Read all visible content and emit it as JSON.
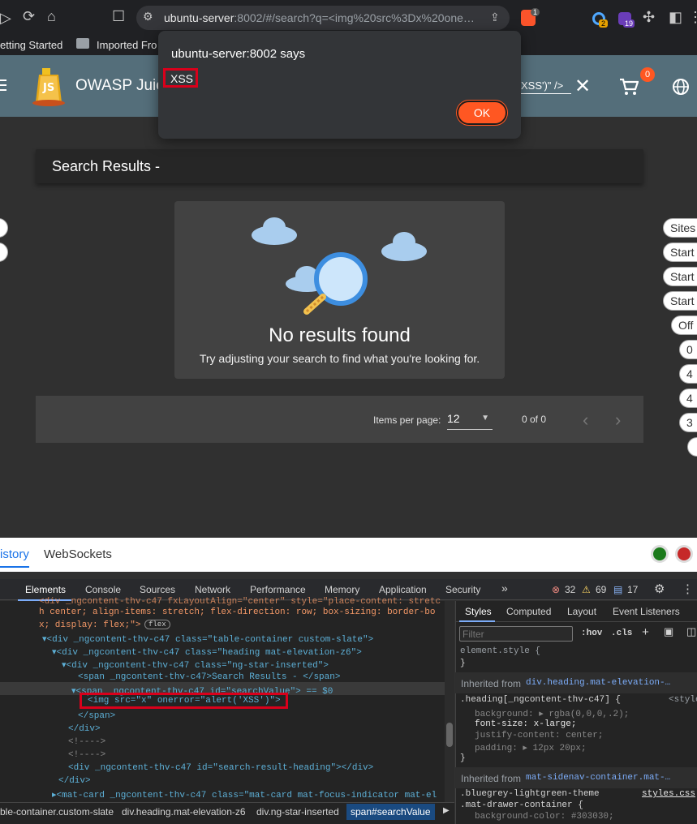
{
  "browser": {
    "url_host": "ubuntu-server",
    "url_rest": ":8002/#/search?q=<img%20src%3Dx%20one…",
    "brave_badge": "1",
    "ext_badge_1": "2",
    "ext_badge_2": "19",
    "bookmarks": [
      "etting Started",
      "Imported Fro"
    ]
  },
  "app": {
    "title": "OWASP Juic",
    "search_fragment": "ert('XSS')\" />",
    "cart_count": "0"
  },
  "alert": {
    "title": "ubuntu-server:8002 says",
    "message": "XSS",
    "ok_label": "OK"
  },
  "main": {
    "heading": "Search Results -",
    "no_results": "No results found",
    "hint": "Try adjusting your search to find what you're looking for.",
    "items_per_page_label": "Items per page:",
    "items_per_page_value": "12",
    "range": "0 of 0"
  },
  "side_chips": [
    "Sites",
    "Start",
    "Start",
    "Start",
    "Off",
    "0",
    "4",
    "4",
    "3"
  ],
  "devtools": {
    "top_tabs": [
      "istory",
      "WebSockets"
    ],
    "tabs": [
      "Elements",
      "Console",
      "Sources",
      "Network",
      "Performance",
      "Memory",
      "Application",
      "Security"
    ],
    "errors": "32",
    "warnings": "69",
    "messages": "17",
    "code_lines": [
      "h center; align-items: stretch; flex-direction: row; box-sizing: border-bo",
      "x; display: flex;\">",
      "<div _ngcontent-thv-c47 class=\"table-container custom-slate\">",
      "<div _ngcontent-thv-c47 class=\"heading mat-elevation-z6\">",
      "<div _ngcontent-thv-c47 class=\"ng-star-inserted\">",
      "<span _ngcontent-thv-c47>Search Results - </span>",
      "<span _ngcontent-thv-c47 id=\"searchValue\"> == $0",
      "<img src=\"x\" onerror=\"alert('XSS')\">",
      "</span>",
      "</div>",
      "<!---->",
      "<!---->",
      "<div _ngcontent-thv-c47 id=\"search-result-heading\"></div>",
      "</div>",
      "<mat-card _ngcontent-thv-c47 class=\"mat-card mat-focus-indicator mat-el"
    ],
    "flex_badge": "flex",
    "breadcrumbs": [
      "ble-container.custom-slate",
      "div.heading.mat-elevation-z6",
      "div.ng-star-inserted",
      "span#searchValue"
    ],
    "styles": {
      "tabs": [
        "Styles",
        "Computed",
        "Layout",
        "Event Listeners"
      ],
      "filter_placeholder": "Filter",
      "hov": ":hov",
      "cls": ".cls",
      "element_style": "element.style {",
      "close": "}",
      "inherited1": "Inherited from",
      "inherited1_target": "div.heading.mat-elevation-…",
      "rule1_selector": ".heading[_ngcontent-thv-c47] {",
      "rule1_source": "<style",
      "rule1_props": [
        "background: ▸ rgba(0,0,0,.2);",
        "font-size: x-large;",
        "justify-content: center;",
        "padding: ▸ 12px 20px;"
      ],
      "inherited2": "Inherited from",
      "inherited2_target": "mat-sidenav-container.mat-…",
      "rule2_selector_a": ".bluegrey-lightgreen-theme",
      "rule2_selector_b": ".mat-drawer-container {",
      "rule2_source": "styles.css",
      "rule2_prop": "background-color: #303030;"
    }
  },
  "colors": {
    "toolbar": "#546e7a",
    "accent": "#ff5722",
    "highlight_box": "#d9001b",
    "page_bg": "#303030"
  }
}
